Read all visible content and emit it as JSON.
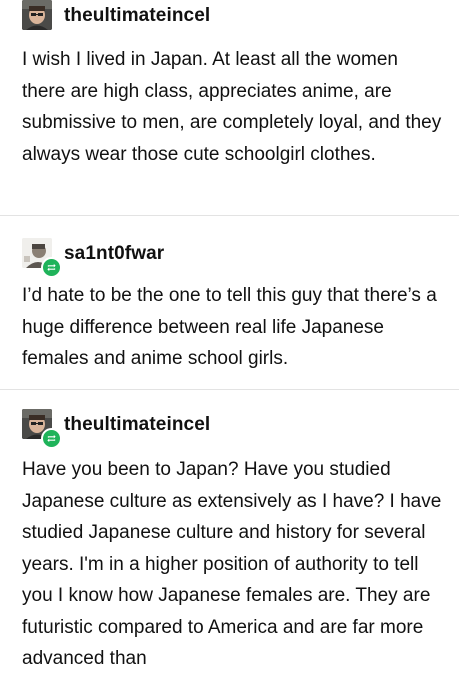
{
  "posts": [
    {
      "username": "theultimateincel",
      "avatar_icon": "profile-photo-dark",
      "reblogged": false,
      "text": "I wish I lived in Japan. At least all the women there are high class,  appreciates anime,  are submissive to men, are completely loyal, and they always wear those cute schoolgirl clothes."
    },
    {
      "username": "sa1nt0fwar",
      "avatar_icon": "profile-photo-light",
      "reblogged": true,
      "text": "I’d hate to be the one to tell this guy that there’s a huge difference between real life Japanese females and anime school girls."
    },
    {
      "username": "theultimateincel",
      "avatar_icon": "profile-photo-dark",
      "reblogged": true,
      "text": "Have you been to Japan? Have you studied Japanese culture as extensively as I have? I have studied Japanese culture and history for several years.  I'm in a higher position of authority to tell you I know how Japanese females are.  They are futuristic compared to America and are far more advanced than"
    }
  ],
  "colors": {
    "reblog_badge": "#1fb35a",
    "divider": "#e3e3e3",
    "text": "#111111"
  }
}
